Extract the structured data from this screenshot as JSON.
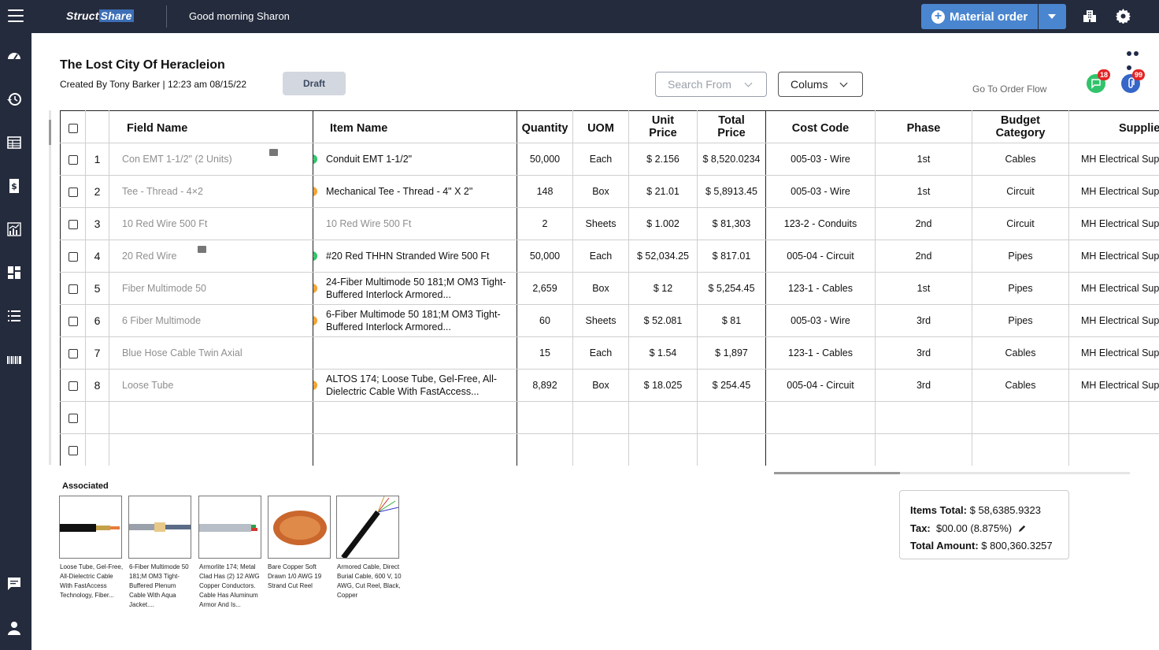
{
  "topbar": {
    "logo_a": "Struct",
    "logo_b": "Share",
    "greeting": "Good morning Sharon",
    "material_order_label": "Material order"
  },
  "header": {
    "title": "The Lost City Of Heracleion",
    "created": "Created By Tony Barker  | 12:23 am  08/15/22",
    "status": "Draft",
    "search_from": "Search From",
    "columns": "Colums",
    "order_flow": "Go To Order Flow",
    "chat_count": "18",
    "attach_count": "99"
  },
  "table": {
    "headers": {
      "field": "Field Name",
      "item": "Item Name",
      "quantity": "Quantity",
      "uom": "UOM",
      "unit_price": "Unit Price",
      "total_price": "Total Price",
      "cost_code": "Cost Code",
      "phase": "Phase",
      "budget": "Budget Category",
      "supplier": "Supplier"
    },
    "rows": [
      {
        "n": "1",
        "field": "Con EMT 1-1/2\"  (2 Units)",
        "item": "Conduit EMT 1-1/2\"",
        "qty": "50,000",
        "uom": "Each",
        "unit": "$ 2.156",
        "total": "$ 8,520.0234",
        "cost": "005-03 - Wire",
        "phase": "1st",
        "budget": "Cables",
        "supplier": "MH Electrical Supply"
      },
      {
        "n": "2",
        "field": " Tee - Thread - 4×2",
        "item": "Mechanical Tee - Thread - 4\" X 2\"",
        "qty": "148",
        "uom": "Box",
        "unit": "$ 21.01",
        "total": "$ 5,8913.45",
        "cost": "005-03 - Wire",
        "phase": "1st",
        "budget": "Circuit",
        "supplier": "MH Electrical Supply"
      },
      {
        "n": "3",
        "field": "10 Red Wire 500 Ft",
        "item": "10 Red Wire 500 Ft",
        "qty": "2",
        "uom": "Sheets",
        "unit": "$ 1.002",
        "total": "$ 81,303",
        "cost": "123-2 - Conduits",
        "phase": "2nd",
        "budget": "Circuit",
        "supplier": "MH Electrical Supply"
      },
      {
        "n": "4",
        "field": "20 Red Wire",
        "item": "#20 Red THHN Stranded Wire 500 Ft",
        "qty": "50,000",
        "uom": "Each",
        "unit": "$ 52,034.25",
        "total": "$ 817.01",
        "cost": "005-04 - Circuit",
        "phase": "2nd",
        "budget": "Pipes",
        "supplier": "MH Electrical Supply"
      },
      {
        "n": "5",
        "field": "Fiber Multimode 50",
        "item": "24-Fiber Multimode 50   181;M OM3 Tight-Buffered Interlock Armored...",
        "qty": "2,659",
        "uom": "Box",
        "unit": "$ 12",
        "total": "$ 5,254.45",
        "cost": "123-1 - Cables",
        "phase": "1st",
        "budget": "Pipes",
        "supplier": "MH Electrical Supply"
      },
      {
        "n": "6",
        "field": "6 Fiber Multimode",
        "item": "6-Fiber Multimode 50   181;M OM3 Tight-Buffered Interlock Armored...",
        "qty": "60",
        "uom": "Sheets",
        "unit": "$ 52.081",
        "total": "$ 81",
        "cost": "005-03 - Wire",
        "phase": "3rd",
        "budget": "Pipes",
        "supplier": "MH Electrical Supply"
      },
      {
        "n": "7",
        "field": "Blue Hose Cable Twin Axial",
        "item": "",
        "qty": "15",
        "uom": "Each",
        "unit": "$ 1.54",
        "total": "$ 1,897",
        "cost": "123-1 - Cables",
        "phase": "3rd",
        "budget": "Cables",
        "supplier": "MH Electrical Supply"
      },
      {
        "n": "8",
        "field": "Loose Tube",
        "item": "ALTOS  174; Loose Tube, Gel-Free, All-Dielectric Cable With FastAccess...",
        "qty": "8,892",
        "uom": "Box",
        "unit": "$ 18.025",
        "total": "$ 254.45",
        "cost": "005-04 - Circuit",
        "phase": "3rd",
        "budget": "Cables",
        "supplier": "MH Electrical Supply"
      }
    ]
  },
  "associated": {
    "label": "Associated",
    "items": [
      {
        "caption": "Loose Tube, Gel-Free, All-Dielectric Cable With FastAccess Technology, Fiber..."
      },
      {
        "caption": "6-Fiber Multimode 50   181;M OM3 Tight-Buffered Plenum Cable With Aqua Jacket...."
      },
      {
        "caption": "Armorlite  174; Metal Clad Has (2) 12 AWG Copper Conductors. Cable Has Aluminum Armor And Is..."
      },
      {
        "caption": "Bare Copper Soft Drawn 1/0 AWG 19 Strand Cut Reel"
      },
      {
        "caption": "Armored Cable, Direct Burial Cable, 600 V, 10 AWG, Cut Reel, Black, Copper"
      }
    ]
  },
  "totals": {
    "items_label": "Items Total:",
    "items_value": "$ 58,6385.9323",
    "tax_label": "Tax:",
    "tax_value": "$00.00 (8.875%)",
    "total_label": "Total Amount:",
    "total_value": "$ 800,360.3257"
  },
  "colors": {
    "topbar": "#242b3d",
    "primary": "#4a86d0",
    "green": "#31c36b",
    "orange": "#f2a332",
    "badge": "#e32424"
  }
}
